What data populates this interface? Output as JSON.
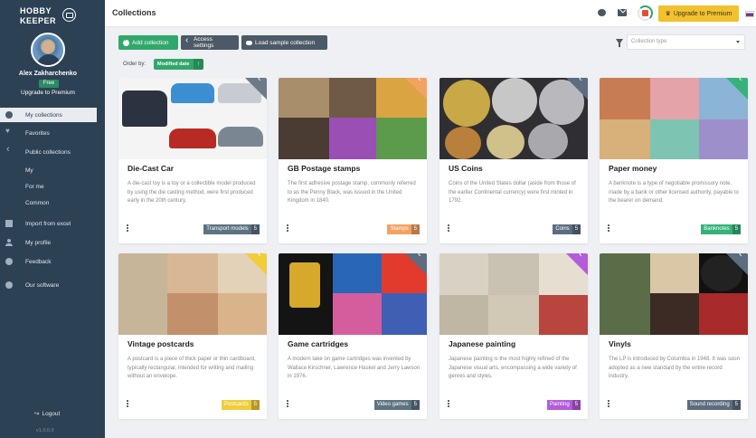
{
  "sidebar": {
    "logo": {
      "line1": "HOBBY",
      "line2": "KEEPER"
    },
    "user_name": "Alex Zakharchenko",
    "plan": "Free",
    "upgrade_link": "Upgrade to Premium",
    "items": [
      {
        "label": "My collections",
        "icon": "dot-icon",
        "active": true
      },
      {
        "label": "Favorites",
        "icon": "heart-icon"
      },
      {
        "label": "Public collections",
        "icon": "share-icon"
      },
      {
        "label": "My",
        "icon": ""
      },
      {
        "label": "For me",
        "icon": ""
      },
      {
        "label": "Common",
        "icon": ""
      },
      {
        "label": "Import from excel",
        "icon": "document-icon"
      },
      {
        "label": "My profile",
        "icon": "user-icon"
      },
      {
        "label": "Feedback",
        "icon": "chat-bubble-icon"
      },
      {
        "label": "Our software",
        "icon": "pin-icon"
      }
    ],
    "logout": "Logout",
    "version": "v1.0.0.0"
  },
  "header": {
    "title": "Collections",
    "upgrade_button": "Upgrade to Premium",
    "language_flag": "ru-flag-icon"
  },
  "toolbar": {
    "add_collection": "Add collection",
    "access_settings": "Access settings",
    "load_sample": "Load sample collection",
    "collection_type_placeholder": "Collection type",
    "order_by_label": "Order by:",
    "order_by_value": "Modified date",
    "order_direction": "↑"
  },
  "colors": {
    "green": "#31a86b",
    "dark": "#2d4154",
    "premium": "#f2c12e"
  },
  "collections": [
    {
      "title": "Die-Cast Car",
      "description": "A die-cast toy is a toy or a collectible model produced by using the die casting method, were first produced early in the 20th century.",
      "tag": "Transport models",
      "count": "5",
      "tag_color": "#5c7382",
      "ribbon_color": "#6c7a88"
    },
    {
      "title": "GB Postage stamps",
      "description": "The first adhesive postage stamp, commonly referred to as the Penny Black, was issued in the United Kingdom in 1840.",
      "tag": "Stamps",
      "count": "5",
      "tag_color": "#f4a261",
      "ribbon_color": "#f4a261"
    },
    {
      "title": "US Coins",
      "description": "Coins of the United States dollar (aside from those of the earlier Continental currency) were first minted in 1792.",
      "tag": "Coins",
      "count": "5",
      "tag_color": "#5c6d80",
      "ribbon_color": "#5c6d80"
    },
    {
      "title": "Paper money",
      "description": "A banknote is a type of negotiable promissory note, made by a bank or other licensed authority, payable to the bearer on demand.",
      "tag": "Banknotes",
      "count": "5",
      "tag_color": "#35b27a",
      "ribbon_color": "#35b27a"
    },
    {
      "title": "Vintage postcards",
      "description": "A postcard is a piece of thick paper or thin cardboard, typically rectangular, intended for writing and mailing without an envelope.",
      "tag": "Postcards",
      "count": "5",
      "tag_color": "#f1cd3a",
      "ribbon_color": "#f1cd3a"
    },
    {
      "title": "Game cartridges",
      "description": "A modern take on game cartridges was invented by Wallace Kirschner, Lawrence Haskel and Jerry Lawson in 1976.",
      "tag": "Video games",
      "count": "5",
      "tag_color": "#5c7382",
      "ribbon_color": "#5c6d80"
    },
    {
      "title": "Japanese painting",
      "description": "Japanese painting is the most highly refined of the Japanese visual arts, encompassing a wide variety of genres and styles.",
      "tag": "Painting",
      "count": "5",
      "tag_color": "#b35bd9",
      "ribbon_color": "#b35bd9"
    },
    {
      "title": "Vinyls",
      "description": "The LP is introduced by Columbia in 1948. It was soon adopted as a new standard by the entire record industry.",
      "tag": "Sound recording",
      "count": "5",
      "tag_color": "#5c6d80",
      "ribbon_color": "#5c6d80"
    }
  ]
}
